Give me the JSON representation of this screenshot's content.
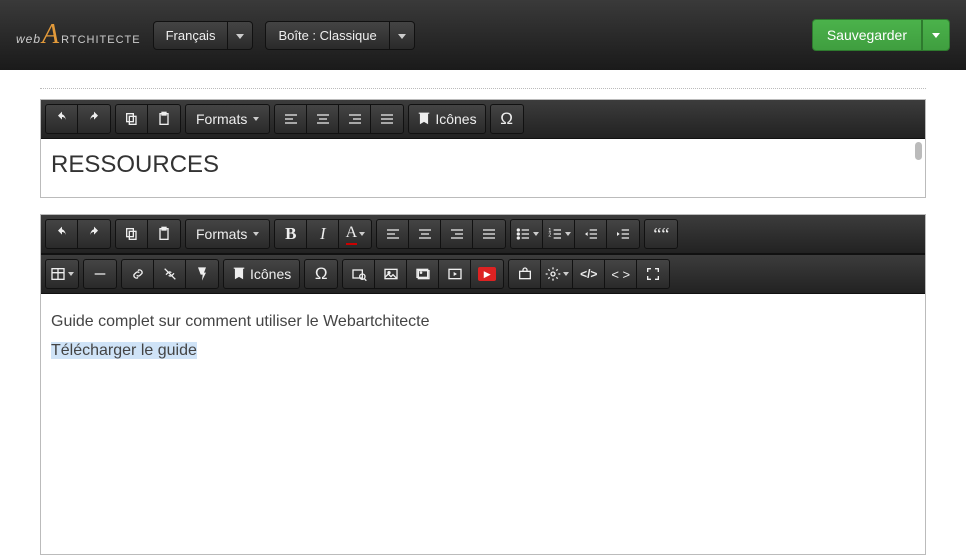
{
  "header": {
    "language_label": "Français",
    "box_label": "Boîte : Classique",
    "save_label": "Sauvegarder"
  },
  "editor1": {
    "formats_label": "Formats",
    "icons_label": "Icônes",
    "title": "RESSOURCES"
  },
  "editor2": {
    "formats_label": "Formats",
    "icons_label": "Icônes",
    "content_line1": "Guide complet sur comment utiliser le Webartchitecte",
    "content_line2": "Télécharger le guide"
  }
}
